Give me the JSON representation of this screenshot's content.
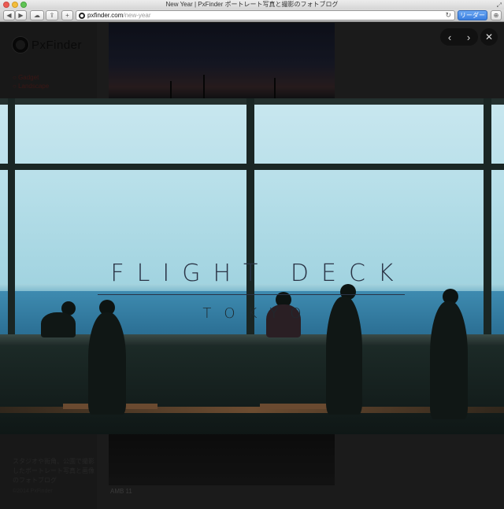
{
  "window": {
    "title": "New Year | PxFinder ポートレート写真と撮影のフォトブログ"
  },
  "toolbar": {
    "back_glyph": "◀",
    "forward_glyph": "▶",
    "icloud_glyph": "☁",
    "share_glyph": "⇪",
    "new_tab_glyph": "+",
    "url_host": "pxfinder.com",
    "url_path": "/new-year",
    "reload_glyph": "↻",
    "reader_label": "リーダー",
    "download_glyph": "⊕"
  },
  "site": {
    "logo_text": "PxFinder",
    "categories": [
      "Gadget",
      "Landscape"
    ],
    "description": "スタジオや街角、公園で撮影したポートレート写真と画像のフォトブログ",
    "copyright": "©2014 PxFinder",
    "caption": "AMB 11"
  },
  "lightbox": {
    "prev_glyph": "‹",
    "next_glyph": "›",
    "close_glyph": "✕",
    "headline": "FLIGHT DECK",
    "subline": "TOKYO"
  },
  "colors": {
    "reader_button": "#3b7fe0",
    "category_link": "#5a2320",
    "headline_ink": "#2a3345"
  }
}
